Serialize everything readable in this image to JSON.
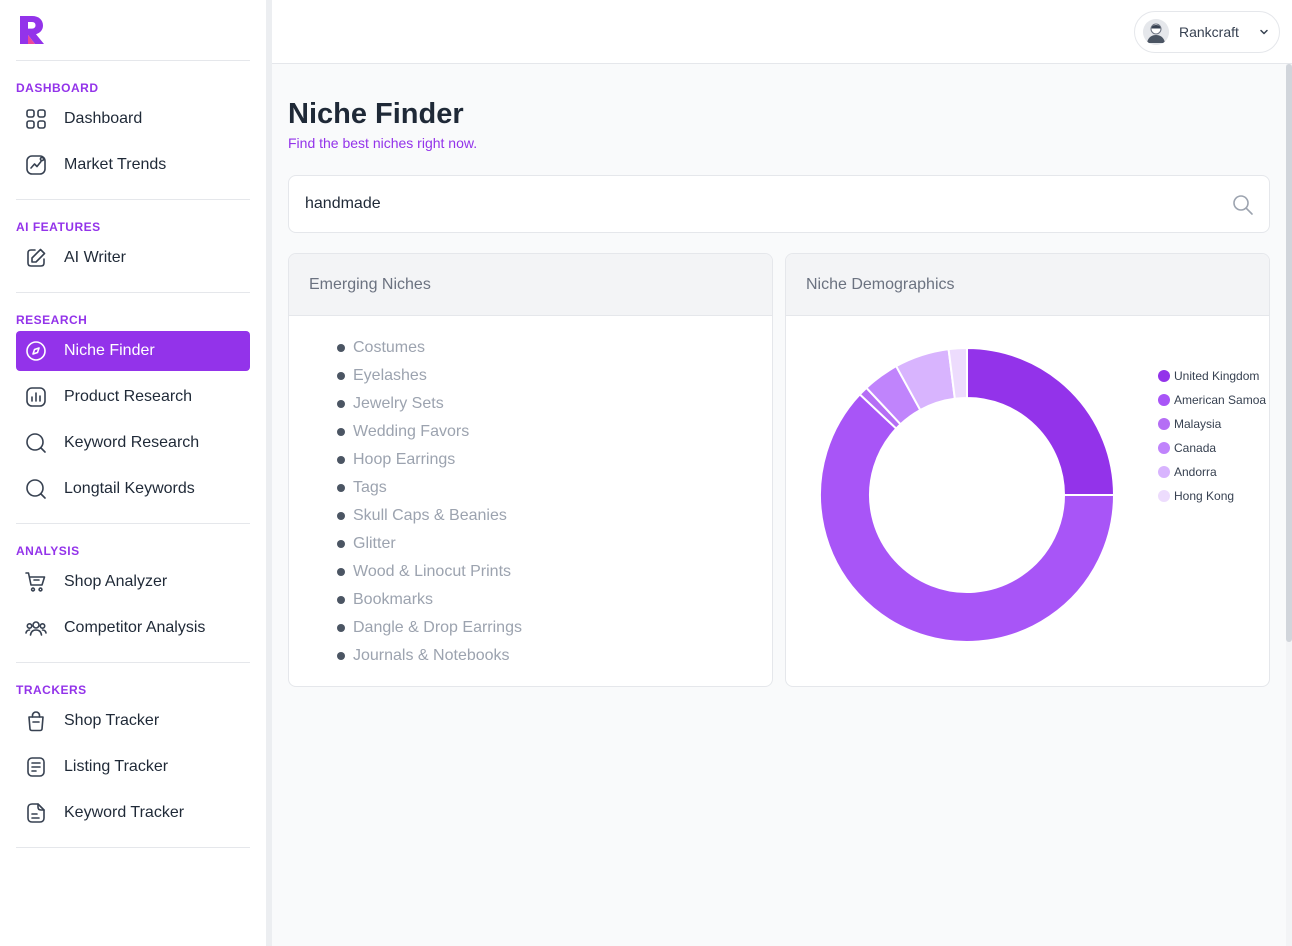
{
  "brand": {
    "color": "#9333ea",
    "logo_colors": [
      "#9333ea",
      "#ec4899"
    ]
  },
  "sidebar": {
    "sections": [
      {
        "title": "DASHBOARD",
        "items": [
          {
            "label": "Dashboard",
            "icon": "grid-icon"
          },
          {
            "label": "Market Trends",
            "icon": "trend-icon"
          }
        ]
      },
      {
        "title": "AI FEATURES",
        "items": [
          {
            "label": "AI Writer",
            "icon": "pencil-icon"
          }
        ]
      },
      {
        "title": "RESEARCH",
        "items": [
          {
            "label": "Niche Finder",
            "icon": "compass-icon",
            "active": true
          },
          {
            "label": "Product Research",
            "icon": "bar-chart-icon"
          },
          {
            "label": "Keyword Research",
            "icon": "search-icon"
          },
          {
            "label": "Longtail Keywords",
            "icon": "search-icon"
          }
        ]
      },
      {
        "title": "ANALYSIS",
        "items": [
          {
            "label": "Shop Analyzer",
            "icon": "cart-icon"
          },
          {
            "label": "Competitor Analysis",
            "icon": "users-icon"
          }
        ]
      },
      {
        "title": "TRACKERS",
        "items": [
          {
            "label": "Shop Tracker",
            "icon": "bag-icon"
          },
          {
            "label": "Listing Tracker",
            "icon": "list-doc-icon"
          },
          {
            "label": "Keyword Tracker",
            "icon": "doc-icon"
          }
        ]
      }
    ]
  },
  "topbar": {
    "user_name": "Rankcraft"
  },
  "page": {
    "title": "Niche Finder",
    "subtitle": "Find the best niches right now."
  },
  "search": {
    "value": "handmade"
  },
  "emerging": {
    "title": "Emerging Niches",
    "items": [
      "Costumes",
      "Eyelashes",
      "Jewelry Sets",
      "Wedding Favors",
      "Hoop Earrings",
      "Tags",
      "Skull Caps & Beanies",
      "Glitter",
      "Wood & Linocut Prints",
      "Bookmarks",
      "Dangle & Drop Earrings",
      "Journals & Notebooks"
    ]
  },
  "demographics": {
    "title": "Niche Demographics",
    "chart_data": {
      "type": "pie",
      "categories": [
        "United Kingdom",
        "American Samoa",
        "Malaysia",
        "Canada",
        "Andorra",
        "Hong Kong"
      ],
      "values": [
        25,
        62,
        1,
        4,
        6,
        2
      ],
      "colors": [
        "#9333ea",
        "#a855f7",
        "#b56ef5",
        "#c084fc",
        "#d8b4fe",
        "#eddcfd"
      ],
      "legend_position": "right"
    }
  }
}
